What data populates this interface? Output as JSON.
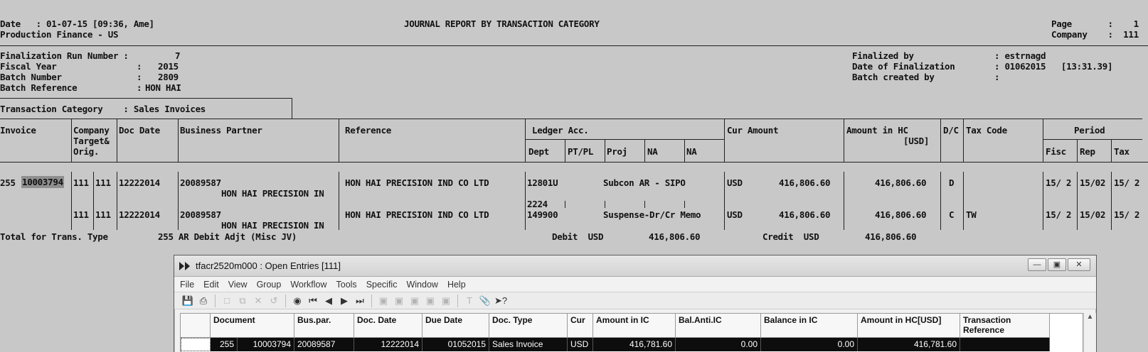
{
  "report": {
    "date_label": "Date   : 01-07-15 [09:36, Ame]",
    "company_name": "Production Finance - US",
    "title": "JOURNAL REPORT BY TRANSACTION CATEGORY",
    "page_label": "Page       :    1",
    "company_label": "Company    :  111",
    "fin_run_label": "Finalization Run Number :",
    "fin_run_value": "7",
    "fiscal_year_label": "Fiscal Year",
    "fiscal_year_value": "2015",
    "batch_number_label": "Batch Number",
    "batch_number_value": "2809",
    "batch_ref_label": "Batch Reference",
    "batch_ref_value": "HON HAI",
    "colon": ":",
    "finalized_by_label": "Finalized by",
    "finalized_by_value": ": estrnagd",
    "date_fin_label": "Date of Finalization",
    "date_fin_value": ": 01062015   [13:31.39]",
    "batch_created_label": "Batch created by",
    "batch_created_value": ":",
    "trans_cat_label": "Transaction Category    : Sales Invoices",
    "columns": {
      "invoice": "Invoice",
      "company1": "Company",
      "company2": "Target&",
      "company3": "Orig.",
      "doc_date": "Doc Date",
      "bp": "Business Partner",
      "reference": "Reference",
      "ledger": "Ledger Acc.",
      "dept": "Dept",
      "ptpl": "PT/PL",
      "proj": "Proj",
      "na1": "NA",
      "na2": "NA",
      "cur_amount": "Cur Amount",
      "amount_hc": "Amount in HC",
      "amount_hc2": "[USD]",
      "dc": "D/C",
      "tax_code": "Tax Code",
      "period": "Period",
      "fisc": "Fisc",
      "rep": "Rep",
      "tax": "Tax"
    },
    "rows": [
      {
        "inv_type": "255",
        "inv_no": "10003794",
        "c1": "111",
        "c2": "111",
        "doc_date": "12222014",
        "bp_code": "20089587",
        "bp_name": "HON HAI PRECISION IN",
        "reference": "HON HAI PRECISION IND CO LTD",
        "ledger": "12801U",
        "ledger_desc": "Subcon AR - SIPO",
        "cur": "USD",
        "cur_amount": "416,806.60",
        "hc_amount": "416,806.60",
        "dc": "D",
        "tax_code": "",
        "fisc": "15/ 2",
        "rep": "15/02",
        "tax": "15/ 2",
        "dept": "2224"
      },
      {
        "inv_type": "",
        "inv_no": "",
        "c1": "111",
        "c2": "111",
        "doc_date": "12222014",
        "bp_code": "20089587",
        "bp_name": "HON HAI PRECISION IN",
        "reference": "HON HAI PRECISION IND CO LTD",
        "ledger": "149900",
        "ledger_desc": "Suspense-Dr/Cr Memo",
        "cur": "USD",
        "cur_amount": "416,806.60",
        "hc_amount": "416,806.60",
        "dc": "C",
        "tax_code": "TW",
        "fisc": "15/ 2",
        "rep": "15/02",
        "tax": "15/ 2"
      }
    ],
    "total": {
      "label": "Total for Trans. Type",
      "type": "255 AR Debit Adjt (Misc JV)",
      "debit_label": "Debit  USD",
      "debit_value": "416,806.60",
      "credit_label": "Credit  USD",
      "credit_value": "416,806.60"
    }
  },
  "window": {
    "title": "tfacr2520m000 : Open Entries [111]",
    "menu": [
      "File",
      "Edit",
      "View",
      "Group",
      "Workflow",
      "Tools",
      "Specific",
      "Window",
      "Help"
    ],
    "grid_headers": [
      "Document",
      "Bus.par.",
      "Doc. Date",
      "Due Date",
      "Doc. Type",
      "Cur",
      "Amount in IC",
      "Bal.Anti.IC",
      "Balance in IC",
      "Amount in HC[USD]",
      "Transaction Reference"
    ],
    "row": {
      "doc_type_no": "255",
      "doc_no": "10003794",
      "bus_par": "20089587",
      "doc_date": "12222014",
      "due_date": "01052015",
      "doc_type": "Sales Invoice",
      "cur": "USD",
      "amount_ic": "416,781.60",
      "bal_anti": "0.00",
      "balance_ic": "0.00",
      "amount_hc": "416,781.60",
      "trans_ref": ""
    }
  }
}
